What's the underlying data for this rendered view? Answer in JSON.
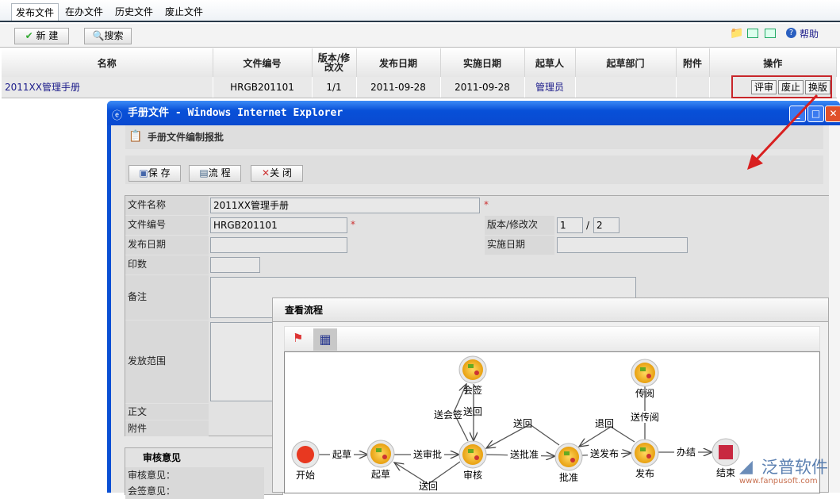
{
  "tabs": [
    "发布文件",
    "在办文件",
    "历史文件",
    "废止文件"
  ],
  "toolbar": {
    "new_label": "新 建",
    "search_label": "搜索",
    "help_label": "帮助"
  },
  "table": {
    "headers": [
      "名称",
      "文件编号",
      "版本/修改次",
      "发布日期",
      "实施日期",
      "起草人",
      "起草部门",
      "附件",
      "操作"
    ],
    "rows": [
      {
        "name": "2011XX管理手册",
        "code": "HRGB201101",
        "version": "1/1",
        "publish": "2011-09-28",
        "effective": "2011-09-28",
        "drafter": "管理员",
        "dept": "",
        "attach": "",
        "actions": [
          "评审",
          "废止",
          "换版"
        ]
      }
    ]
  },
  "ie": {
    "title": "手册文件 - Windows Internet Explorer",
    "section_title": "手册文件编制报批",
    "buttons": [
      "保 存",
      "流 程",
      "关 闭"
    ],
    "form": {
      "name_label": "文件名称",
      "name_value": "2011XX管理手册",
      "code_label": "文件编号",
      "code_value": "HRGB201101",
      "version_label": "版本/修改次",
      "version_value": "1",
      "revision_value": "2",
      "sep": "/",
      "publish_label": "发布日期",
      "effective_label": "实施日期",
      "print_label": "印数",
      "remark_label": "备注",
      "scope_label": "发放范围",
      "body_label": "正文",
      "attach_label": "附件",
      "required": "*"
    },
    "review": {
      "title": "审核意见",
      "opinion_label": "审核意见：",
      "countersign_label": "会签意见："
    }
  },
  "flow": {
    "title": "查看流程",
    "nodes": {
      "start": "开始",
      "draft": "起草",
      "review": "审核",
      "countersign": "会签",
      "approve": "批准",
      "publish": "发布",
      "circulate": "传阅",
      "end": "结束"
    },
    "edges": {
      "e1": "起草",
      "e2": "送审批",
      "e3": "送回",
      "e4": "送会签",
      "e5": "送回",
      "e6": "送批准",
      "e7": "送回",
      "e8": "送发布",
      "e9": "退回",
      "e10": "送传阅",
      "e11": "办结"
    }
  },
  "watermark": {
    "brand": "泛普软件",
    "url": "www.fanpusoft.com"
  }
}
